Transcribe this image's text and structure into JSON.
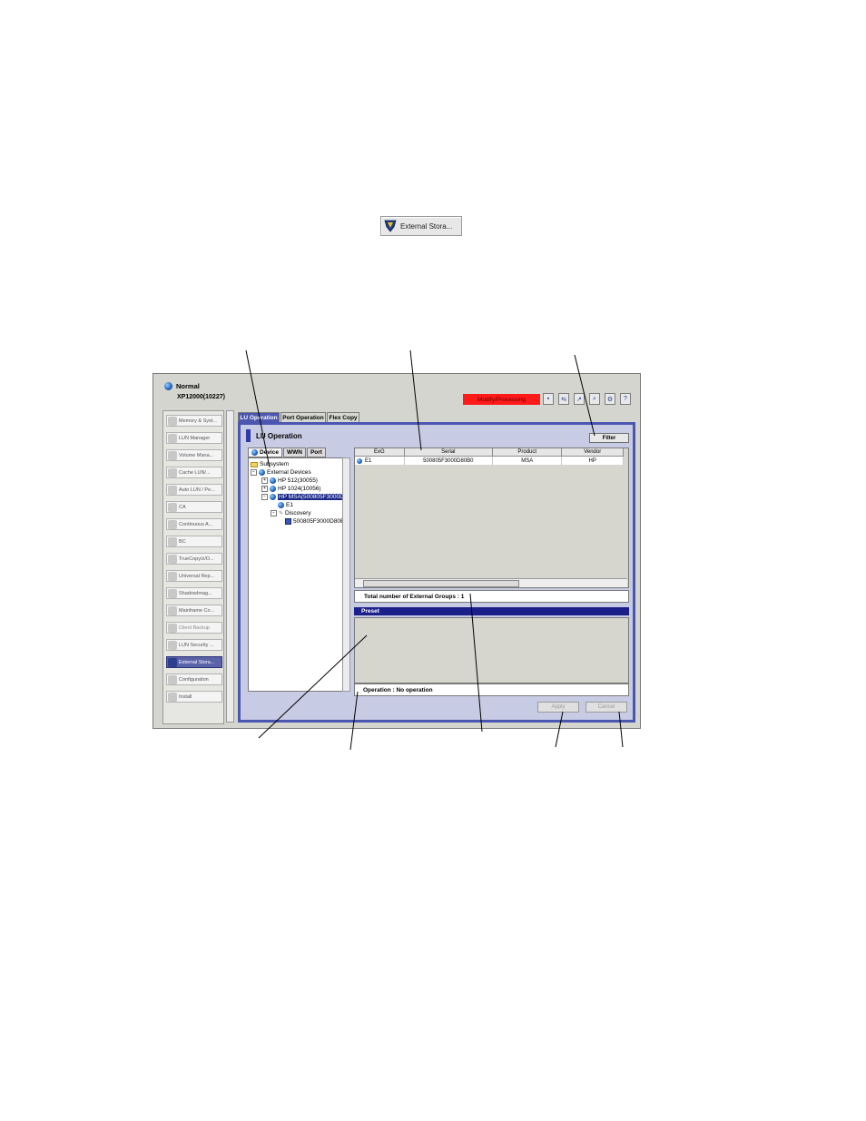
{
  "toolbar_button": {
    "label": "External Stora...",
    "icon": "external-storage-icon"
  },
  "window": {
    "status": "Normal",
    "model": "XP12000(10227)",
    "mode_badge": "Modify/Processing",
    "accent": "#4b56b0",
    "badge_color": "#ff1a1a",
    "programs": [
      {
        "label": "Memory & Syst..."
      },
      {
        "label": "LUN Manager"
      },
      {
        "label": "Volume Mana..."
      },
      {
        "label": "Cache LUN/..."
      },
      {
        "label": "Auto LUN / Pe..."
      },
      {
        "label": "CA"
      },
      {
        "label": "Continuous A..."
      },
      {
        "label": "BC"
      },
      {
        "label": "TrueCopy/z/O..."
      },
      {
        "label": "Universal Rep..."
      },
      {
        "label": "ShadowImag..."
      },
      {
        "label": "Mainframe Co..."
      },
      {
        "label": "Client Backup"
      },
      {
        "label": "LUN Security ..."
      },
      {
        "label": "External Stora..."
      },
      {
        "label": "Configuration"
      },
      {
        "label": "Install"
      }
    ],
    "main_tabs": [
      "LU Operation",
      "Port Operation",
      "Flex Copy"
    ],
    "panel_title": "LU Operation",
    "filter_label": "Filter",
    "tree_tabs": [
      "Device",
      "WWN",
      "Port"
    ],
    "tree": {
      "root": "Subsystem",
      "external_devices": "External Devices",
      "hp512": "HP 512(30055)",
      "hp1024": "HP 1024(10056)",
      "hpmsa": "HP MSA(500805F3000D8",
      "e1": "E1",
      "discovery": "Discovery",
      "disc_item": "500805F3000D80B"
    },
    "table": {
      "columns": [
        "ExG",
        "Serial",
        "Product",
        "Vendor"
      ],
      "rows": [
        {
          "exg": "E1",
          "serial": "500805F3000D80B0",
          "product": "MSA",
          "vendor": "HP"
        }
      ]
    },
    "total_text": "Total number of External Groups : 1",
    "preset_label": "Preset",
    "operation_text": "Operation : No operation",
    "apply_label": "Apply",
    "cancel_label": "Cancel"
  }
}
